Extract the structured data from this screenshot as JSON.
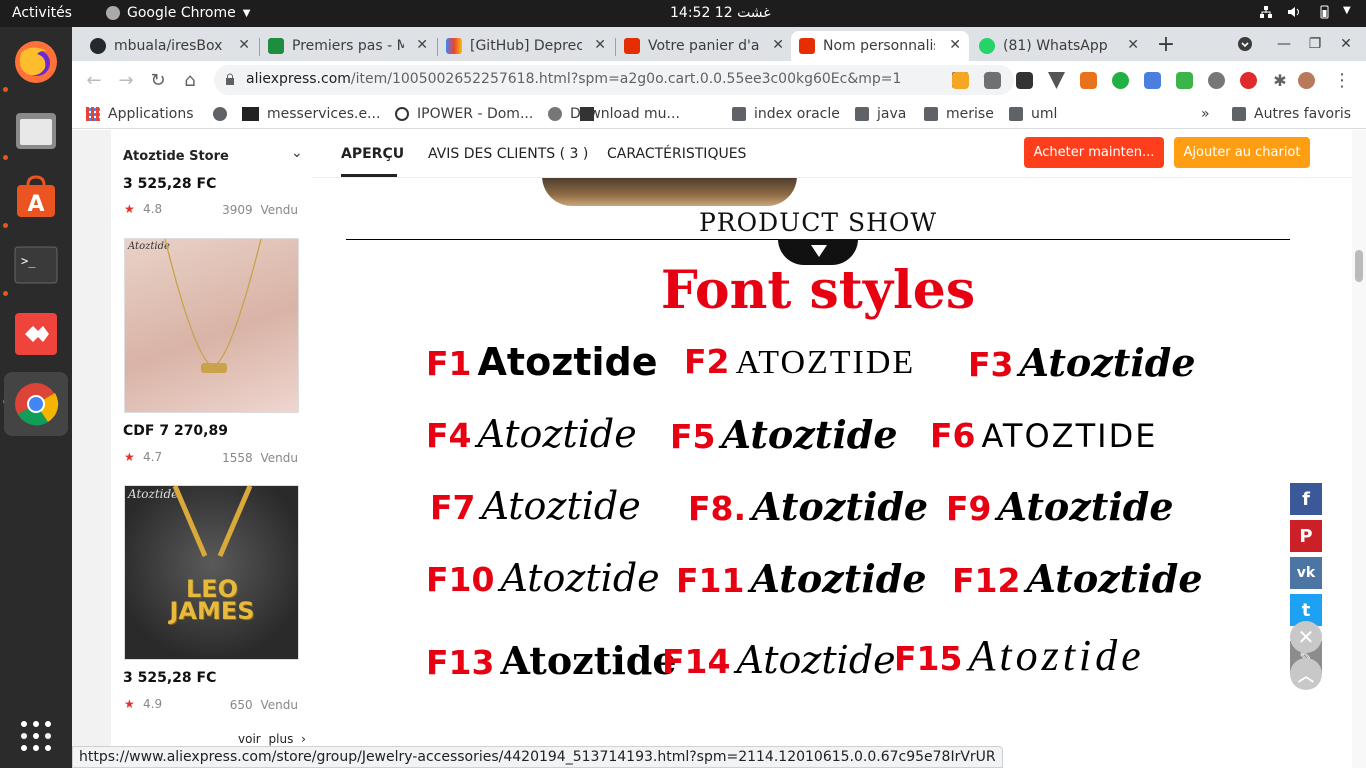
{
  "topbar": {
    "activities": "Activités",
    "app_menu": "Google Chrome",
    "clock": "14:52  12 غشت"
  },
  "tabs": [
    {
      "title": "mbuala/iresBox",
      "icon": "github-icon",
      "color": "#24292e"
    },
    {
      "title": "Premiers pas - M",
      "icon": "google-classroom-icon",
      "color": "#1e8e3e"
    },
    {
      "title": "[GitHub] Deprec",
      "icon": "gmail-icon",
      "color": "#ea4335"
    },
    {
      "title": "Votre panier d'ac",
      "icon": "aliexpress-icon",
      "color": "#e62e04"
    },
    {
      "title": "Nom personnalis",
      "icon": "aliexpress-icon",
      "color": "#e62e04",
      "active": true
    },
    {
      "title": "(81) WhatsApp",
      "icon": "whatsapp-icon",
      "color": "#25d366"
    }
  ],
  "omnibox": {
    "host": "aliexpress.com",
    "path": "/item/1005002652257618.html?spm=a2g0o.cart.0.0.55ee3c00kg60Ec&mp=1"
  },
  "bookmarks": [
    {
      "label": "Applications",
      "icon": "apps-grid-icon"
    },
    {
      "label": "",
      "icon": "globe-icon"
    },
    {
      "label": "messervices.e...",
      "icon": "etu-icon"
    },
    {
      "label": "IPOWER - Dom...",
      "icon": "power-icon"
    },
    {
      "label": "Download mu...",
      "icon": "download-icon"
    },
    {
      "label": "index oracle",
      "icon": "folder-icon"
    },
    {
      "label": "java",
      "icon": "folder-icon"
    },
    {
      "label": "merise",
      "icon": "folder-icon"
    },
    {
      "label": "uml",
      "icon": "folder-icon"
    }
  ],
  "bookmarks_overflow": "»",
  "other_bookmarks": "Autres favoris",
  "store": {
    "name": "Atoztide Store",
    "products": [
      {
        "price": "3 525,28 FC",
        "rating": "4.8",
        "sold": "3909 Vendu"
      },
      {
        "price": "CDF 7 270,89",
        "rating": "4.7",
        "sold": "1558 Vendu",
        "image_text": "Atoztide"
      },
      {
        "price": "3 525,28 FC",
        "rating": "4.9",
        "sold": "650 Vendu",
        "image_text": "Atoztide",
        "pendant_text": "LEO JAMES"
      }
    ],
    "see_more": "voir plus ›"
  },
  "product_tabs": {
    "overview": "APERÇU",
    "reviews": "AVIS DES CLIENTS  ( 3 )",
    "specs": "CARACTÉRISTIQUES"
  },
  "buttons": {
    "buy_now": "Acheter mainten...",
    "add_to_cart": "Ajouter au chariot",
    "buy_color": "#ff3f1c",
    "cart_color": "#ff9e12"
  },
  "description": {
    "product_show": "PRODUCT SHOW",
    "font_styles_title": "Font styles",
    "font_word": "Atoztide",
    "font_word_caps": "ATOZTIDE",
    "codes": [
      "F1",
      "F2",
      "F3",
      "F4",
      "F5",
      "F6",
      "F7",
      "F8.",
      "F9",
      "F10",
      "F11",
      "F12",
      "F13",
      "F14",
      "F15"
    ]
  },
  "share": [
    {
      "name": "facebook",
      "glyph": "f",
      "color": "#3b5998"
    },
    {
      "name": "pinterest",
      "glyph": "P",
      "color": "#cb2027"
    },
    {
      "name": "vk",
      "glyph": "vk",
      "color": "#4c75a3"
    },
    {
      "name": "twitter",
      "glyph": "t",
      "color": "#1da1f2"
    },
    {
      "name": "edit",
      "glyph": "✎",
      "color": "#8c8c8c"
    }
  ],
  "status_url": "https://www.aliexpress.com/store/group/Jewelry-accessories/4420194_513714193.html?spm=2114.12010615.0.0.67c95e78IrVrUR"
}
